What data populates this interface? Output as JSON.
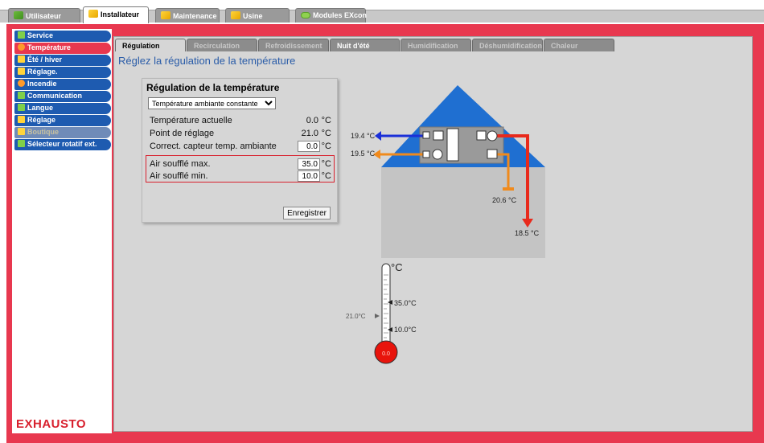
{
  "top_tabs": [
    {
      "label": "Utilisateur",
      "icon": "users-icon",
      "active": false
    },
    {
      "label": "Installateur",
      "icon": "wrench-user-icon",
      "active": true
    },
    {
      "label": "Maintenance",
      "icon": "maintenance-icon",
      "active": false
    },
    {
      "label": "Usine",
      "icon": "factory-icon",
      "active": false
    },
    {
      "label": "Modules EXcon",
      "icon": "modules-icon",
      "active": false
    }
  ],
  "sidebar": {
    "items": [
      {
        "label": "Service",
        "icon": "service-icon",
        "state": "normal"
      },
      {
        "label": "Température",
        "icon": "thermometer-icon",
        "state": "active"
      },
      {
        "label": "Été / hiver",
        "icon": "sun-icon",
        "state": "normal"
      },
      {
        "label": "Réglage.",
        "icon": "pencil-icon",
        "state": "normal"
      },
      {
        "label": "Incendie",
        "icon": "fire-icon",
        "state": "normal"
      },
      {
        "label": "Communication",
        "icon": "communication-icon",
        "state": "normal"
      },
      {
        "label": "Langue",
        "icon": "flag-icon",
        "state": "normal"
      },
      {
        "label": "Réglage",
        "icon": "folder-icon",
        "state": "normal"
      },
      {
        "label": "Boutique",
        "icon": "cart-icon",
        "state": "disabled"
      },
      {
        "label": "Sélecteur rotatif ext.",
        "icon": "rotary-selector-icon",
        "state": "normal"
      }
    ]
  },
  "logo": "EXHAUSTO",
  "sub_tabs": [
    {
      "label": "Régulation",
      "active": true
    },
    {
      "label": "Recirculation",
      "active": false
    },
    {
      "label": "Refroidissement",
      "active": false
    },
    {
      "label": "Nuit d'été",
      "active": false
    },
    {
      "label": "Humidification",
      "active": false
    },
    {
      "label": "Déshumidification",
      "active": false
    },
    {
      "label": "Chaleur",
      "active": false
    }
  ],
  "page_title": "Réglez la régulation de la température",
  "regulation": {
    "title": "Régulation de la température",
    "mode_selected": "Température ambiante constante",
    "actual_temp_label": "Température actuelle",
    "actual_temp_value": "0.0",
    "setpoint_label": "Point de réglage",
    "setpoint_value": "21.0",
    "sensor_corr_label": "Correct. capteur temp. ambiante",
    "sensor_corr_value": "0.0",
    "supply_max_label": "Air soufflé max.",
    "supply_max_value": "35.0",
    "supply_min_label": "Air soufflé min.",
    "supply_min_value": "10.0",
    "unit": "°C",
    "save_label": "Enregistrer"
  },
  "diagram": {
    "outdoor_in": "19.4 °C",
    "exhaust_out": "19.5 °C",
    "extract_in": "20.6 °C",
    "supply_out": "18.5 °C",
    "colors": {
      "roof": "#1f6fd1",
      "room": "#c4c4c4",
      "supply": "#e82a1c",
      "extract": "#f08a1c",
      "outdoor": "#1a2fd8"
    }
  },
  "thermometer": {
    "unit_label": "°C",
    "max_label": "35.0°C",
    "min_label": "10.0°C",
    "setpoint_label": "21.0°C",
    "bulb_value": "0.0"
  }
}
